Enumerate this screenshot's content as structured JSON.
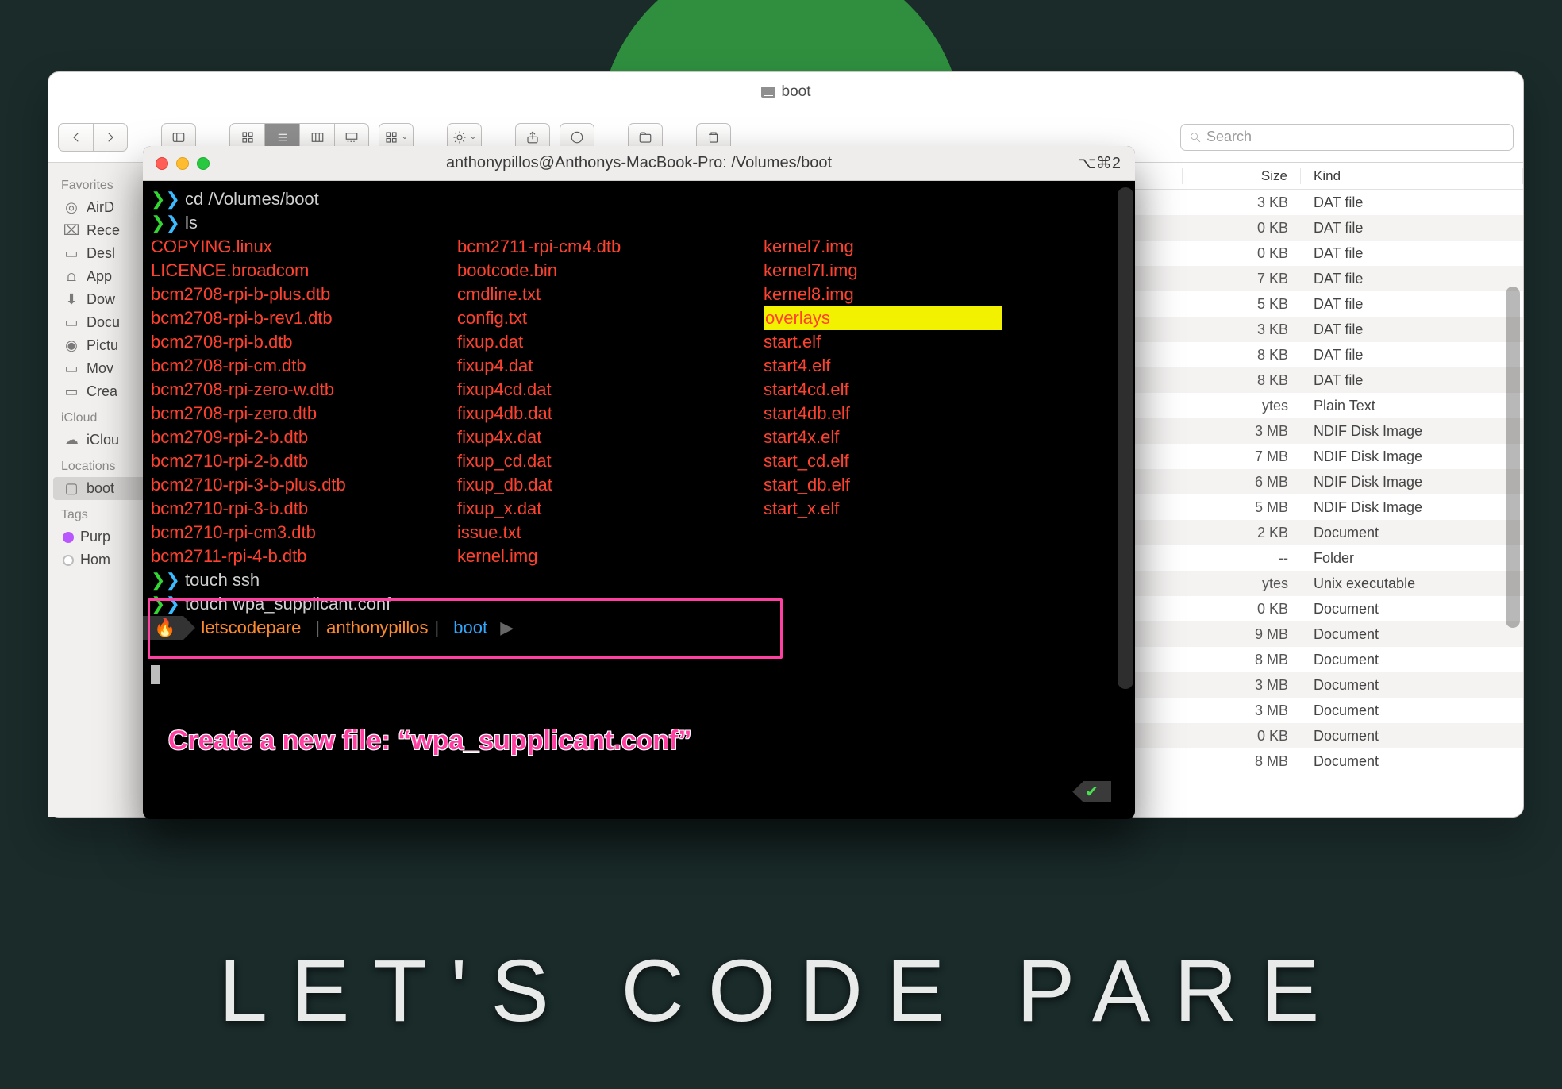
{
  "background_logo": "LET'S CODE PARE",
  "finder": {
    "title": "boot",
    "toolbar": {
      "search_placeholder": "Search"
    },
    "sidebar": {
      "favorites_header": "Favorites",
      "favorites": [
        "AirD",
        "Rece",
        "Desl",
        "App",
        "Dow",
        "Docu",
        "Pictu",
        "Mov",
        "Crea"
      ],
      "icloud_header": "iCloud",
      "icloud": [
        "iClou"
      ],
      "locations_header": "Locations",
      "locations": [
        "boot"
      ],
      "tags_header": "Tags",
      "tags": [
        {
          "label": "Purp",
          "color": "#b957ff"
        },
        {
          "label": "Hom",
          "color": "#fff",
          "ring": "#bdbdbd"
        }
      ]
    },
    "columns": {
      "size": "Size",
      "kind": "Kind"
    },
    "rows": [
      {
        "size": "3 KB",
        "kind": "DAT file"
      },
      {
        "size": "0 KB",
        "kind": "DAT file"
      },
      {
        "size": "0 KB",
        "kind": "DAT file"
      },
      {
        "size": "7 KB",
        "kind": "DAT file"
      },
      {
        "size": "5 KB",
        "kind": "DAT file"
      },
      {
        "size": "3 KB",
        "kind": "DAT file"
      },
      {
        "size": "8 KB",
        "kind": "DAT file"
      },
      {
        "size": "8 KB",
        "kind": "DAT file"
      },
      {
        "size": "ytes",
        "kind": "Plain Text"
      },
      {
        "size": "3 MB",
        "kind": "NDIF Disk Image"
      },
      {
        "size": "7 MB",
        "kind": "NDIF Disk Image"
      },
      {
        "size": "6 MB",
        "kind": "NDIF Disk Image"
      },
      {
        "size": "5 MB",
        "kind": "NDIF Disk Image"
      },
      {
        "size": "2 KB",
        "kind": "Document"
      },
      {
        "size": "--",
        "kind": "Folder"
      },
      {
        "size": "ytes",
        "kind": "Unix executable"
      },
      {
        "size": "0 KB",
        "kind": "Document"
      },
      {
        "size": "9 MB",
        "kind": "Document"
      },
      {
        "size": "8 MB",
        "kind": "Document"
      },
      {
        "size": "3 MB",
        "kind": "Document"
      },
      {
        "size": "3 MB",
        "kind": "Document"
      },
      {
        "size": "0 KB",
        "kind": "Document"
      },
      {
        "size": "8 MB",
        "kind": "Document"
      }
    ]
  },
  "terminal": {
    "title": "anthonypillos@Anthonys-MacBook-Pro: /Volumes/boot",
    "shortcut": "⌥⌘2",
    "cmd_cd": "cd /Volumes/boot",
    "cmd_ls": "ls",
    "cmd_touch_ssh": "touch ssh",
    "cmd_touch_wpa": "touch wpa_supplicant.conf",
    "ls_columns": [
      [
        "COPYING.linux",
        "LICENCE.broadcom",
        "bcm2708-rpi-b-plus.dtb",
        "bcm2708-rpi-b-rev1.dtb",
        "bcm2708-rpi-b.dtb",
        "bcm2708-rpi-cm.dtb",
        "bcm2708-rpi-zero-w.dtb",
        "bcm2708-rpi-zero.dtb",
        "bcm2709-rpi-2-b.dtb",
        "bcm2710-rpi-2-b.dtb",
        "bcm2710-rpi-3-b-plus.dtb",
        "bcm2710-rpi-3-b.dtb",
        "bcm2710-rpi-cm3.dtb",
        "bcm2711-rpi-4-b.dtb"
      ],
      [
        "bcm2711-rpi-cm4.dtb",
        "bootcode.bin",
        "cmdline.txt",
        "config.txt",
        "fixup.dat",
        "fixup4.dat",
        "fixup4cd.dat",
        "fixup4db.dat",
        "fixup4x.dat",
        "fixup_cd.dat",
        "fixup_db.dat",
        "fixup_x.dat",
        "issue.txt",
        "kernel.img"
      ],
      [
        "kernel7.img",
        "kernel7l.img",
        "kernel8.img",
        "overlays",
        "start.elf",
        "start4.elf",
        "start4cd.elf",
        "start4db.elf",
        "start4x.elf",
        "start_cd.elf",
        "start_db.elf",
        "start_x.elf"
      ]
    ],
    "powerline": {
      "project": "letscodepare",
      "user": "anthonypillos",
      "path": "boot"
    },
    "annotation": "Create a new file: “wpa_supplicant.conf”"
  }
}
